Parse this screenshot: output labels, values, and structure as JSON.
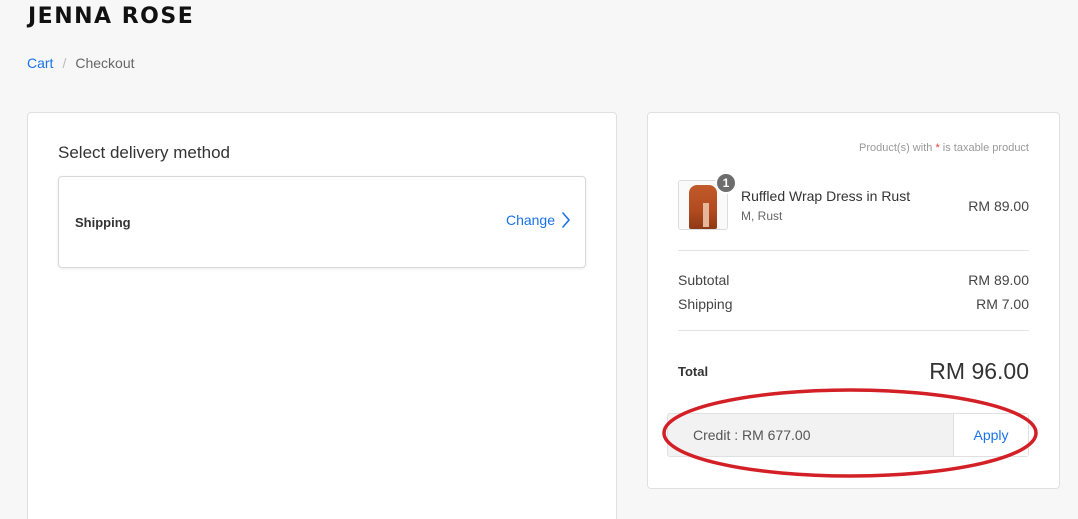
{
  "header": {
    "brand": "JENNA ROSE"
  },
  "breadcrumb": {
    "cart": "Cart",
    "separator": "/",
    "current": "Checkout"
  },
  "delivery": {
    "title": "Select delivery method",
    "method_label": "Shipping",
    "change_label": "Change"
  },
  "summary": {
    "tax_note_prefix": "Product(s) with ",
    "tax_note_star": "*",
    "tax_note_suffix": " is taxable product",
    "product": {
      "quantity": "1",
      "name": "Ruffled Wrap Dress in Rust",
      "variant": "M, Rust",
      "price": "RM 89.00"
    },
    "subtotal_label": "Subtotal",
    "subtotal_value": "RM 89.00",
    "shipping_label": "Shipping",
    "shipping_value": "RM 7.00",
    "total_label": "Total",
    "total_value": "RM 96.00",
    "credit_text": "Credit : RM 677.00",
    "apply_label": "Apply"
  },
  "colors": {
    "accent": "#1a73e8",
    "highlight": "#d32026",
    "taxable_star": "#e53935",
    "qty_badge": "#6d6d6d"
  },
  "icons": {
    "change": "chevron-right-icon",
    "product_image": "dress-thumbnail"
  }
}
